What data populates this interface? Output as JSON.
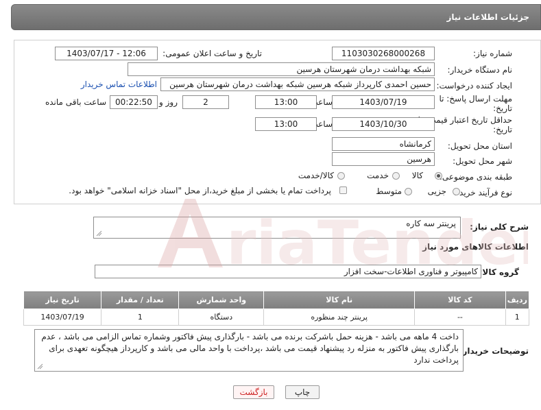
{
  "header": {
    "title": "جزئیات اطلاعات نیاز"
  },
  "form": {
    "need_number_label": "شماره نیاز:",
    "need_number": "1103030268000268",
    "announce_label": "تاریخ و ساعت اعلان عمومی:",
    "announce_value": "1403/07/17 - 12:06",
    "buyer_org_label": "نام دستگاه خریدار:",
    "buyer_org": "شبکه بهداشت درمان شهرستان هرسین",
    "creator_label": "ایجاد کننده درخواست:",
    "creator": "حسین احمدی کارپرداز شبکه هرسین شبکه بهداشت درمان شهرستان هرسین",
    "contact_link": "اطلاعات تماس خریدار",
    "reply_deadline_label_1": "مهلت ارسال پاسخ: تا",
    "reply_deadline_label_2": "تاریخ:",
    "reply_date": "1403/07/19",
    "time_label": "ساعت",
    "reply_time": "13:00",
    "days_value": "2",
    "days_label": "روز و",
    "remaining_time": "00:22:50",
    "remaining_label": "ساعت باقی مانده",
    "validity_label_1": "حداقل تاریخ اعتبار قیمت: تا",
    "validity_label_2": "تاریخ:",
    "validity_date": "1403/10/30",
    "validity_time": "13:00",
    "province_label": "استان محل تحویل:",
    "province": "کرمانشاه",
    "city_label": "شهر محل تحویل:",
    "city": "هرسین",
    "category_label": "طبقه بندی موضوعی:",
    "category_options": [
      "کالا",
      "خدمت",
      "کالا/خدمت"
    ],
    "category_selected": "کالا",
    "process_label": "نوع فرآیند خرید :",
    "process_options": [
      "جزیی",
      "متوسط"
    ],
    "process_selected": "جزیی",
    "payment_note": "پرداخت تمام یا بخشی از مبلغ خرید،از محل \"اسناد خزانه اسلامی\" خواهد بود."
  },
  "description": {
    "label": "شرح کلی نیاز:",
    "value": "پرینتر سه کاره"
  },
  "goods_section_title": "اطلاعات کالاهای مورد نیاز",
  "goods_group": {
    "label": "گروه کالا:",
    "value": "کامپیوتر و فناوری اطلاعات-سخت افزار"
  },
  "table": {
    "headers": [
      "ردیف",
      "کد کالا",
      "نام کالا",
      "واحد شمارش",
      "تعداد / مقدار",
      "تاریخ نیاز"
    ],
    "rows": [
      [
        "1",
        "--",
        "پرینتر چند منظوره",
        "دستگاه",
        "1",
        "1403/07/19"
      ]
    ]
  },
  "buyer_notes": {
    "label": "توضیحات خریدار:",
    "value": "داخت 4 ماهه می باشد - هزینه حمل باشرکت برنده می باشد - بارگذاری پیش فاکتور وشماره تماس الزامی می باشد ، عدم بارگذاری پیش فاکتور به منزله رد پیشنهاد قیمت می باشد ،پرداخت با واحد مالی می باشد و کارپرداز هیچگونه تعهدی برای پرداخت ندارد"
  },
  "buttons": {
    "print": "چاپ",
    "back": "بازگشت"
  },
  "watermark": {
    "text": "AriaTender.neT"
  },
  "colors": {
    "header_bg": "#7a7a7a",
    "link": "#1a4fb0",
    "back_btn_text": "#cc2222",
    "watermark": "#e2b8b8"
  }
}
